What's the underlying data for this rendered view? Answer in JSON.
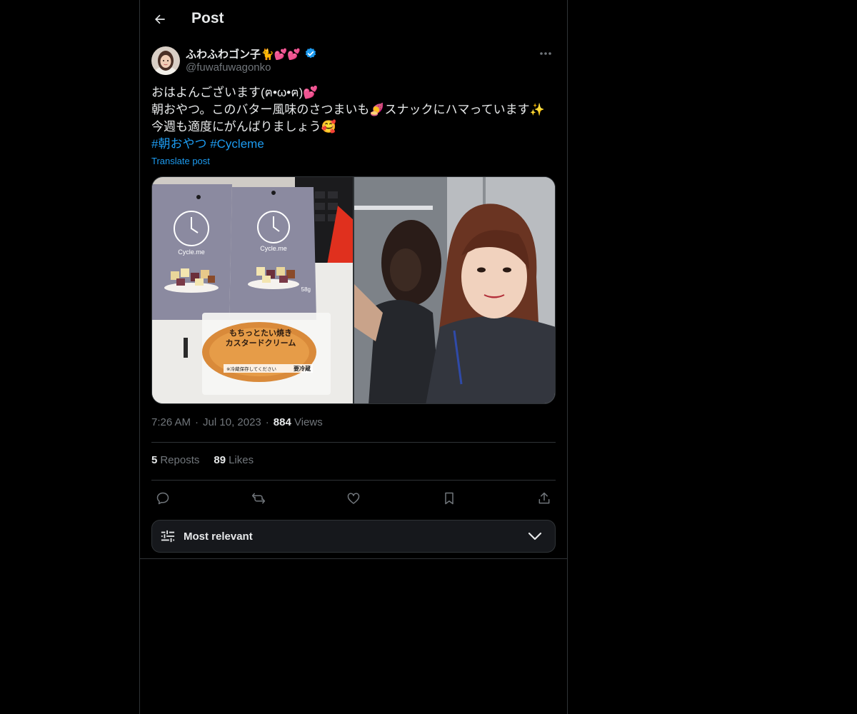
{
  "header": {
    "title": "Post"
  },
  "author": {
    "display_name": "ふわふわゴン子🐈💕💕",
    "handle": "@fuwafuwagonko"
  },
  "post": {
    "lines": [
      "おはよんございます(ฅ•ω•ฅ)💕",
      "朝おやつ。このバター風味のさつまいも🍠スナックにハマっています✨",
      "今週も適度にがんばりましょう🥰"
    ],
    "hashtags": [
      "#朝おやつ",
      "#Cycleme"
    ],
    "translate_label": "Translate post"
  },
  "media": {
    "left_photo": {
      "bag_brand": "Cycle.me",
      "bag_weight": "58g",
      "pastry_line1": "もちっとたい焼き",
      "pastry_line2": "カスタードクリーム",
      "pastry_note": "※冷蔵保存してください",
      "pastry_badge": "要冷蔵"
    }
  },
  "meta": {
    "time": "7:26 AM",
    "date": "Jul 10, 2023",
    "views_count": "884",
    "views_label": "Views",
    "separator": "·"
  },
  "stats": {
    "reposts_count": "5",
    "reposts_label": "Reposts",
    "likes_count": "89",
    "likes_label": "Likes"
  },
  "sort": {
    "label": "Most relevant"
  },
  "colors": {
    "background": "#000000",
    "text_primary": "#e7e9ea",
    "text_secondary": "#71767b",
    "accent": "#1d9bf0",
    "border": "#2f3336",
    "sort_bg": "#16181c"
  },
  "icons": {
    "back": "arrow-left-icon",
    "verified": "verified-badge-icon",
    "more": "more-horizontal-icon",
    "reply": "reply-icon",
    "repost": "repost-icon",
    "like": "heart-icon",
    "bookmark": "bookmark-icon",
    "share": "share-icon",
    "sort": "sliders-icon",
    "chevron": "chevron-down-icon"
  }
}
